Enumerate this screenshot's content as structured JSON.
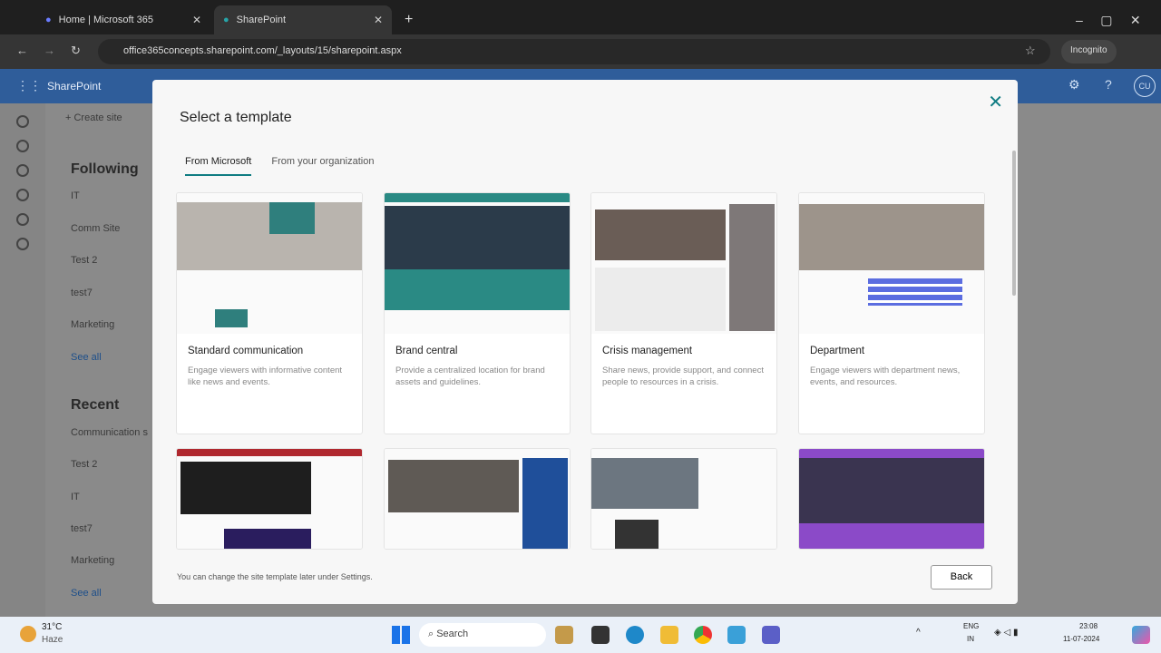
{
  "browser": {
    "tabs": [
      {
        "label": "Home | Microsoft 365"
      },
      {
        "label": "SharePoint"
      }
    ],
    "url": "office365concepts.sharepoint.com/_layouts/15/sharepoint.aspx",
    "incognito": "Incognito"
  },
  "app": {
    "name": "SharePoint",
    "create_site": "+ Create site",
    "avatar": "CU"
  },
  "leftnav": {
    "following_title": "Following",
    "following": [
      "IT",
      "Comm Site",
      "Test 2",
      "test7",
      "Marketing"
    ],
    "following_see_all": "See all",
    "recent_title": "Recent",
    "recent": [
      "Communication s",
      "Test 2",
      "IT",
      "test7",
      "Marketing"
    ],
    "recent_see_all": "See all"
  },
  "dialog": {
    "title": "Select a template",
    "tabs": [
      "From Microsoft",
      "From your organization"
    ],
    "templates": [
      {
        "name": "Standard communication",
        "desc": "Engage viewers with informative content like news and events."
      },
      {
        "name": "Brand central",
        "desc": "Provide a centralized location for brand assets and guidelines."
      },
      {
        "name": "Crisis management",
        "desc": "Share news, provide support, and connect people to resources in a crisis."
      },
      {
        "name": "Department",
        "desc": "Engage viewers with department news, events, and resources."
      }
    ],
    "footer": "You can change the site template later under Settings.",
    "back": "Back"
  },
  "taskbar": {
    "temp": "31°C",
    "weather": "Haze",
    "search": "Search",
    "lang1": "ENG",
    "lang2": "IN",
    "time": "23:08",
    "date": "11-07-2024"
  }
}
